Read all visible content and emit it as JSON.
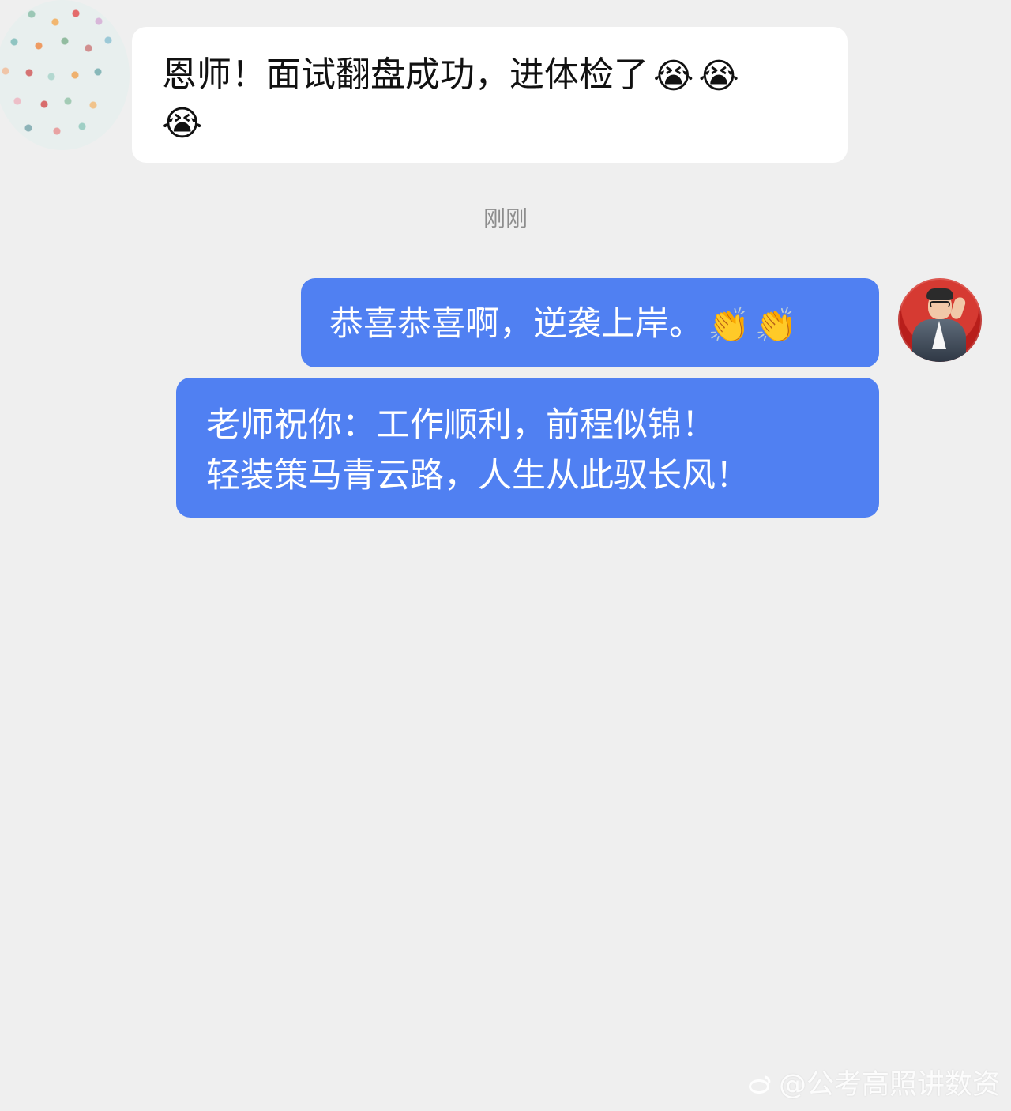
{
  "messages": {
    "incoming": {
      "line1": "恩师！面试翻盘成功，进体检了",
      "line1_emojis": [
        "😭",
        "😭"
      ],
      "line2_emoji": "😭"
    },
    "timestamp": "刚刚",
    "outgoing_1": {
      "text": "恭喜恭喜啊，逆袭上岸。",
      "emojis": [
        "👏",
        "👏"
      ]
    },
    "outgoing_2": {
      "line1": "老师祝你：工作顺利，前程似锦！",
      "line2": "轻装策马青云路，人生从此驭长风！"
    }
  },
  "watermark": {
    "text": "@公考高照讲数资"
  },
  "colors": {
    "background": "#efefef",
    "incoming_bubble": "#ffffff",
    "outgoing_bubble": "#5080f2",
    "timestamp": "#8d8d8d"
  },
  "icons": {
    "left_avatar": "polka-dot-avatar",
    "right_avatar": "user-portrait-avatar",
    "watermark_icon": "weibo-icon"
  }
}
